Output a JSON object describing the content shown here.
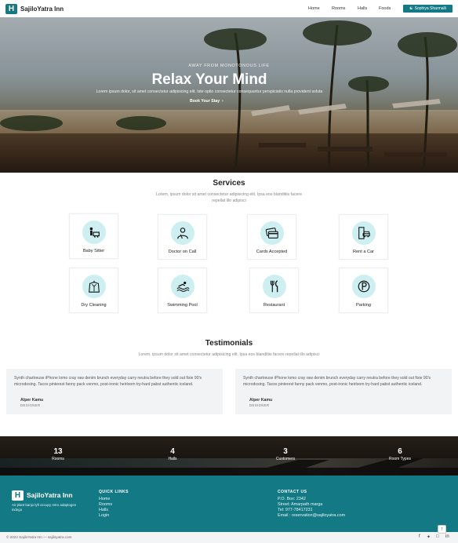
{
  "nav": {
    "logo_letter": "H",
    "brand": "SajiloYatra Inn",
    "links": [
      "Home",
      "Rooms",
      "Halls",
      "Foods"
    ],
    "user_button": "Sophiya Sharmalli"
  },
  "hero": {
    "subtitle": "AWAY FROM MONOTONOUS LIFE",
    "title": "Relax Your Mind",
    "description": "Lorem ipsum dolor, sit amet consectetur adipisicing elit. Iste optio consectetur consequuntur perspiciatis nulla provident soluta",
    "cta": "Book Your Stay"
  },
  "services": {
    "title": "Services",
    "description_line1": "Lorem, ipsum dolor sit amet consectetur adipisicing elit. Ipsa eos blanditiis facere",
    "description_line2": "repellat illo adipisci",
    "items": [
      {
        "label": "Baby Sitter",
        "icon": "baby-sitter-icon"
      },
      {
        "label": "Doctor on Call",
        "icon": "doctor-icon"
      },
      {
        "label": "Cards Accepted",
        "icon": "credit-card-icon"
      },
      {
        "label": "Rent a Car",
        "icon": "car-rental-icon"
      },
      {
        "label": "Dry Cleaning",
        "icon": "dry-cleaning-icon"
      },
      {
        "label": "Swimming Pool",
        "icon": "swimming-pool-icon"
      },
      {
        "label": "Restaurant",
        "icon": "restaurant-icon"
      },
      {
        "label": "Parking",
        "icon": "parking-icon"
      }
    ]
  },
  "testimonials": {
    "title": "Testimonials",
    "description": "Lorem, ipsum dolor sit amet consectetur adipisicing elit. Ipsa eos blanditiis facere repellat illo adipisci",
    "items": [
      {
        "text": "Synth chartreuse iPhone lomo cray raw denim brunch everyday carry neutra before they sold out fixie 90's microdosing. Tacos pinterest fanny pack venmo, post-ironic heirloom try-hard pabst authentic iceland.",
        "name": "Alper Kamu",
        "role": "DESIGNER"
      },
      {
        "text": "Synth chartreuse iPhone lomo cray raw denim brunch everyday carry neutra before they sold out fixie 90's microdosing. Tacos pinterest fanny pack venmo, post-ironic heirloom try-hard pabst authentic iceland.",
        "name": "Alper Kamu",
        "role": "DESIGNER"
      }
    ]
  },
  "stats": [
    {
      "number": "13",
      "label": "Rooms"
    },
    {
      "number": "4",
      "label": "Halls"
    },
    {
      "number": "3",
      "label": "Customers"
    },
    {
      "number": "6",
      "label": "Room Types"
    }
  ],
  "footer": {
    "logo_letter": "H",
    "brand": "SajiloYatra Inn",
    "about": "Air plant banjo lyft occupy retro adaptogen indego",
    "quick_links_title": "QUICK LINKS",
    "quick_links": [
      "Home",
      "Rooms",
      "Halls",
      "Login"
    ],
    "contact_title": "CONTACT US",
    "contact": [
      "P.O. Box: 2342",
      "Street: Amarpath marga",
      "Tel: 977-78417231",
      "Email : reservation@sajiloyatra.com"
    ]
  },
  "bottom": {
    "copyright": "© 2022 SajiloYatra Inn — sajiloyatra.com",
    "social_icons": [
      "facebook-icon",
      "twitter-icon",
      "instagram-icon",
      "linkedin-icon"
    ]
  },
  "colors": {
    "accent": "#137a85",
    "icon_bg": "#cdeff2"
  }
}
